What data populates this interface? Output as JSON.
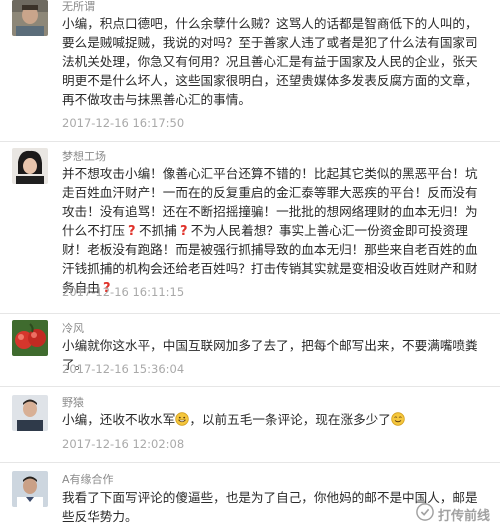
{
  "comments": [
    {
      "name": "无所谓",
      "text": "小编，积点口德吧，什么余孽什么贼？这骂人的话都是智商低下的人叫的，要么是贼喊捉贼，我说的对吗？至于善家人违了或者是犯了什么法有国家司法机关处理，你急又有何用？况且善心汇是有益于国家及人民的企业，张天明更不是什么坏人，这些国家很明白，还望贵媒体多发表反腐方面的文章，再不做攻击与抹黑善心汇的事情。",
      "time": "2017-12-16 16:17:50"
    },
    {
      "name": "梦想工场",
      "p1": "并不想攻击小编！像善心汇平台还算不错的！比起其它类似的黑恶平台！坑走百姓血汗财产！一而在的反复重启的金汇泰等罪大恶疾的平台！反而没有攻击！没有追骂！还在不断招摇撞骗！一批批的想网络理财的血本无归！为什么不打压",
      "p2": "不抓捕",
      "p3": "不为人民着想？事实上善心汇一份资金即可投资理财！老板没有跑路！而是被强行抓捕导致的血本无归！那些来自老百姓的血汗钱抓捕的机构会还给老百姓吗？打击传销其实就是变相没收百姓财产和财务自由",
      "time": "2017-12-16 16:11:15"
    },
    {
      "name": "冷风",
      "text": "小编就你这水平，中国互联网加多了去了，把每个邮写出来，不要满嘴喷粪了。",
      "time": "2017-12-16 15:36:04"
    },
    {
      "name": "野猿",
      "p1": "小编，还收不收水军",
      "p2": "，以前五毛一条评论，现在涨多少了",
      "time": "2017-12-16 12:02:08"
    },
    {
      "name": "A有缘合作",
      "text": "我看了下面写评论的傻逼些，也是为了自己，你他妈的邮不是中国人，邮是些反华势力。"
    }
  ],
  "watermark": {
    "text": "打传前线"
  },
  "colors": {
    "name": "#8a8a8a",
    "time": "#a9a9a9",
    "question_mark": "#e0322a",
    "divider": "#e6e6e6"
  }
}
